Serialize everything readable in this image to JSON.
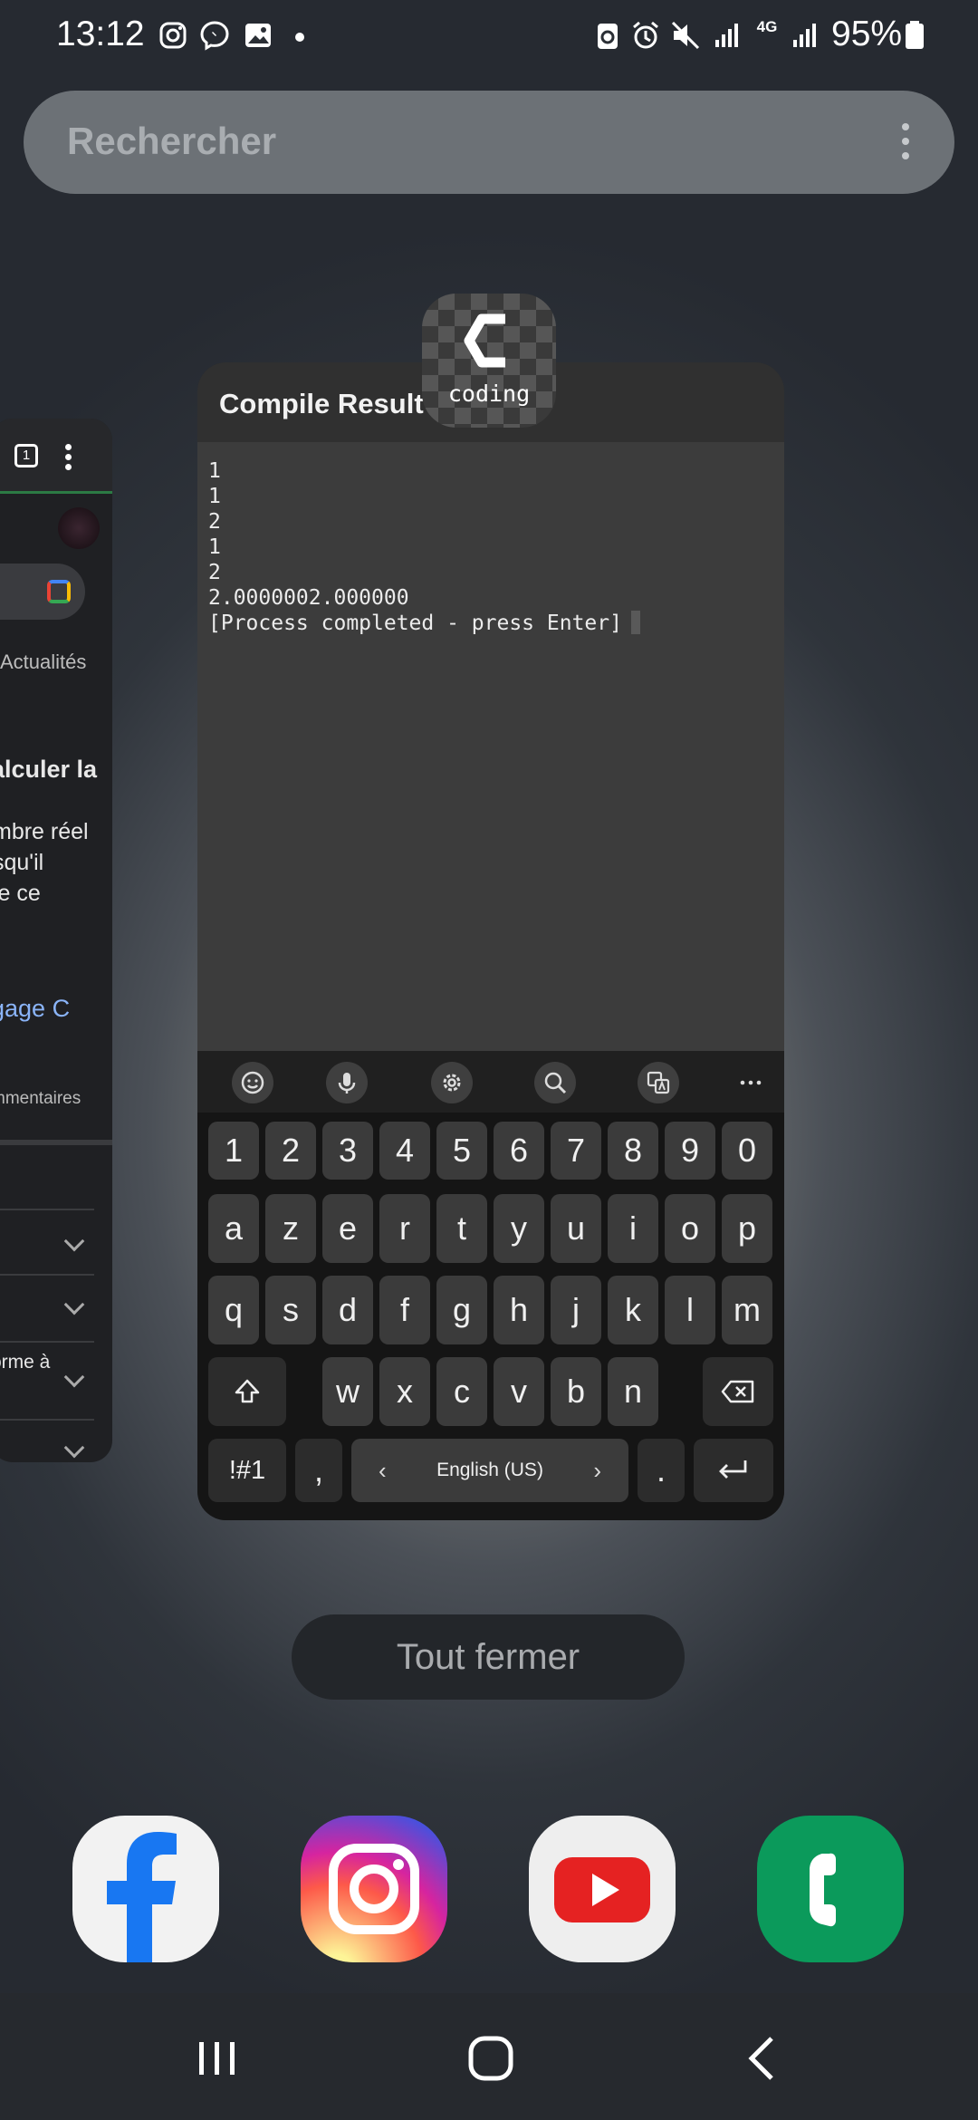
{
  "status_bar": {
    "time": "13:12",
    "battery_percent": "95%",
    "icons": [
      "instagram-icon",
      "messenger-icon",
      "gallery-icon",
      "dot-icon",
      "battery-saver-icon",
      "alarm-icon",
      "mute-icon",
      "signal-icon",
      "4g-icon",
      "signal-icon"
    ],
    "network_label": "4G"
  },
  "search": {
    "placeholder": "Rechercher"
  },
  "left_card": {
    "tab_count": "1",
    "tab_label": "Actualités",
    "heading": "alculer la",
    "snippet_line1": "mbre réel",
    "snippet_line2": "squ'il",
    "snippet_line3": "le ce",
    "link_text": "gage C",
    "comments_label": "mmentaires",
    "list_item_text": "orme à"
  },
  "main_card": {
    "title": "Compile Result",
    "app_label": "coding",
    "terminal_lines": [
      "1",
      "1",
      "2",
      "1",
      "2",
      "2.0000002.000000",
      "[Process completed - press Enter]"
    ]
  },
  "keyboard": {
    "number_row": [
      "1",
      "2",
      "3",
      "4",
      "5",
      "6",
      "7",
      "8",
      "9",
      "0"
    ],
    "row1": [
      "a",
      "z",
      "e",
      "r",
      "t",
      "y",
      "u",
      "i",
      "o",
      "p"
    ],
    "row2": [
      "q",
      "s",
      "d",
      "f",
      "g",
      "h",
      "j",
      "k",
      "l",
      "m"
    ],
    "row3": [
      "w",
      "x",
      "c",
      "v",
      "b",
      "n"
    ],
    "symbols_key": "!#1",
    "comma_key": ",",
    "space_label": "English (US)",
    "period_key": ".",
    "toolbar_icons": [
      "emoji-icon",
      "microphone-icon",
      "settings-icon",
      "search-icon",
      "translate-icon",
      "more-icon"
    ]
  },
  "close_all_label": "Tout fermer",
  "dock": [
    "facebook-icon",
    "instagram-icon",
    "youtube-icon",
    "phone-icon"
  ],
  "colors": {
    "facebook_blue": "#1877f2",
    "youtube_red": "#e52222",
    "phone_green": "#0b9a5b",
    "background_dark": "#262a31"
  }
}
